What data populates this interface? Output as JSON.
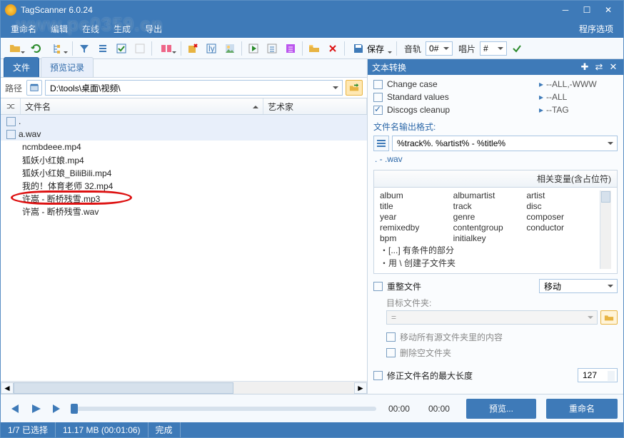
{
  "title": "TagScanner 6.0.24",
  "watermark": "www.pc0359.cn",
  "menus": [
    "重命名",
    "编辑",
    "在线",
    "生成",
    "导出"
  ],
  "program_settings": "程序选项",
  "toolbar": {
    "save_label": "保存",
    "track_label": "音轨",
    "track_value": "0#",
    "disc_label": "唱片",
    "disc_value": "#"
  },
  "tabs": {
    "file": "文件",
    "preview": "预览记录"
  },
  "pathbar": {
    "label": "路径",
    "value": "D:\\tools\\桌面\\视频\\"
  },
  "filehead": {
    "name": "文件名",
    "artist": "艺术家"
  },
  "files": [
    "ncmbdeee.mp4",
    "狐妖小红娘.mp4",
    "狐妖小红娘_BiliBili.mp4",
    "我的！体育老师 32.mp4",
    "许嵩 - 断桥残雪.mp3",
    "许嵩 - 断桥残雪.wav"
  ],
  "file_selected": "a.wav",
  "text_transform": {
    "title": "文本转换",
    "rows": [
      {
        "name": "Change case",
        "val": "--ALL,-WWW",
        "checked": false
      },
      {
        "name": "Standard values",
        "val": "--ALL",
        "checked": false
      },
      {
        "name": "Discogs cleanup",
        "val": "--TAG",
        "checked": true
      }
    ]
  },
  "format": {
    "label": "文件名输出格式:",
    "value": "%track%. %artist% - %title%",
    "output_example": ". - .wav"
  },
  "vars": {
    "header": "相关变量(含占位符)",
    "cells": [
      [
        "album",
        "albumartist",
        "artist"
      ],
      [
        "title",
        "track",
        "disc"
      ],
      [
        "year",
        "genre",
        "composer"
      ],
      [
        "remixedby",
        "contentgroup",
        "conductor"
      ],
      [
        "bpm",
        "initialkey",
        ""
      ]
    ],
    "notes": [
      "・[...] 有条件的部分",
      "・用 \\ 创建子文件夹"
    ]
  },
  "reorganize": {
    "label": "重整文件",
    "mode": "移动"
  },
  "dest": {
    "label": "目标文件夹:",
    "value": "="
  },
  "subchecks": [
    "移动所有源文件夹里的内容",
    "删除空文件夹"
  ],
  "maxlen": {
    "label": "修正文件名的最大长度",
    "value": "127"
  },
  "player": {
    "time_cur": "00:00",
    "time_total": "00:00"
  },
  "actions": {
    "preview": "预览...",
    "rename": "重命名"
  },
  "status": {
    "sel": "1/7 已选择",
    "size": "11.17 MB  (00:01:06)",
    "done": "完成"
  }
}
